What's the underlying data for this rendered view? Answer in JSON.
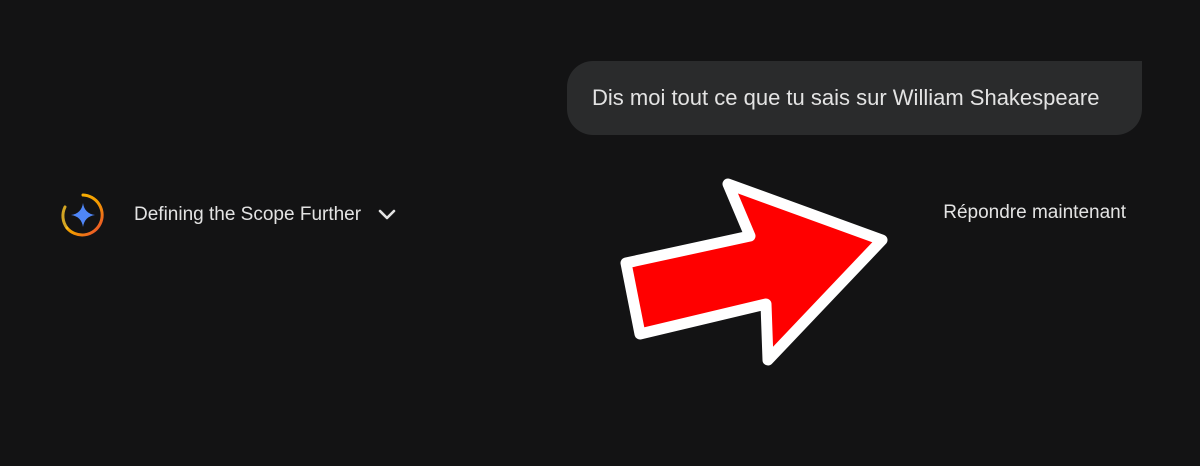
{
  "chat": {
    "user_message": "Dis moi tout ce que tu sais sur William Shakespeare"
  },
  "thinking": {
    "label": "Defining the Scope Further",
    "expand_icon": "chevron-down-icon",
    "spinner_icon": "gemini-sparkle-icon"
  },
  "actions": {
    "answer_now_label": "Répondre maintenant"
  },
  "annotation": {
    "overlay_icon": "red-arrow-icon",
    "color": "#ff0000"
  },
  "colors": {
    "background": "#131314",
    "bubble": "#2a2b2c",
    "text": "#e3e3e3",
    "sparkle": "#4f86f7"
  }
}
